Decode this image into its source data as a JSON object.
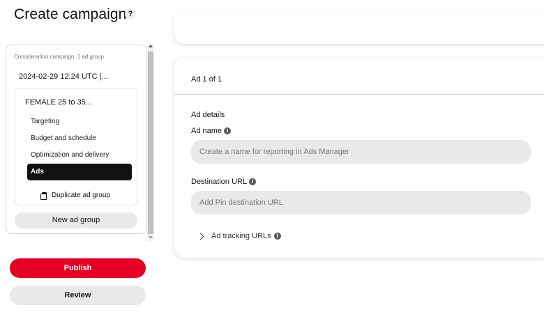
{
  "header": {
    "title": "Create campaign",
    "help_label": "?"
  },
  "sidebar": {
    "campaign_caption": "Consideration campaign, 1 ad group",
    "campaign_date": "2024-02-29 12:24 UTC |...",
    "ad_group": {
      "name": "FEMALE 25 to 35...",
      "items": [
        {
          "label": "Targeting",
          "active": false
        },
        {
          "label": "Budget and schedule",
          "active": false
        },
        {
          "label": "Optimization and delivery",
          "active": false
        },
        {
          "label": "Ads",
          "active": true
        }
      ],
      "duplicate_label": "Duplicate ad group"
    },
    "new_ad_group_label": "New ad group"
  },
  "actions": {
    "publish_label": "Publish",
    "review_label": "Review"
  },
  "ad_card": {
    "counter": "Ad 1 of 1",
    "section_title": "Ad details",
    "ad_name": {
      "label": "Ad name",
      "value": "",
      "placeholder": "Create a name for reporting in Ads Manager"
    },
    "destination_url": {
      "label": "Destination URL",
      "value": "",
      "placeholder": "Add Pin destination URL"
    },
    "tracking_label": "Ad tracking URLs"
  },
  "icons": {
    "info": "info-icon",
    "duplicate": "duplicate-icon",
    "chevron": "chevron-right-icon"
  },
  "colors": {
    "brand_red": "#e60023",
    "active_nav": "#111111",
    "input_bg": "#e9e9e9"
  }
}
